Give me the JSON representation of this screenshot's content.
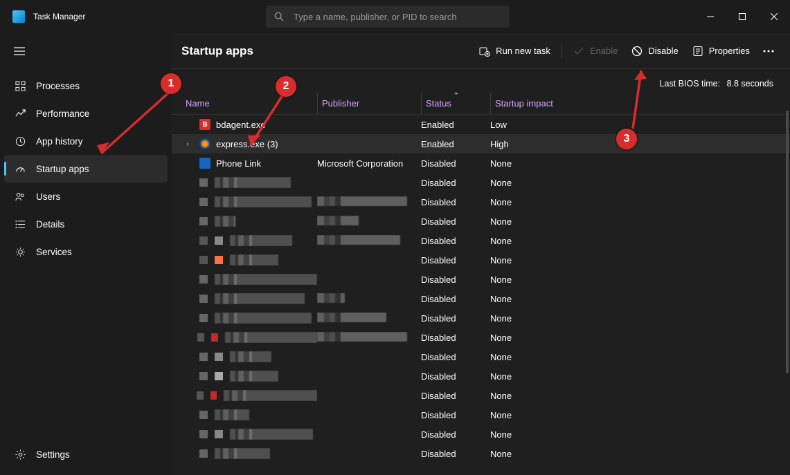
{
  "app": {
    "title": "Task Manager"
  },
  "search": {
    "placeholder": "Type a name, publisher, or PID to search"
  },
  "window": {
    "minimize": "−",
    "maximize": "▢",
    "close": "✕"
  },
  "sidebar": {
    "items": [
      {
        "icon": "processes",
        "label": "Processes"
      },
      {
        "icon": "performance",
        "label": "Performance"
      },
      {
        "icon": "history",
        "label": "App history"
      },
      {
        "icon": "startup",
        "label": "Startup apps"
      },
      {
        "icon": "users",
        "label": "Users"
      },
      {
        "icon": "details",
        "label": "Details"
      },
      {
        "icon": "services",
        "label": "Services"
      }
    ],
    "settings": "Settings"
  },
  "page": {
    "title": "Startup apps",
    "toolbar": {
      "run_new_task": "Run new task",
      "enable": "Enable",
      "disable": "Disable",
      "properties": "Properties"
    },
    "bios_label": "Last BIOS time:",
    "bios_value": "8.8 seconds"
  },
  "columns": {
    "name": "Name",
    "publisher": "Publisher",
    "status": "Status",
    "impact": "Startup impact"
  },
  "rows": [
    {
      "icon": "#d32f2f",
      "iconText": "B",
      "name": "bdagent.exe",
      "publisher": "",
      "status": "Enabled",
      "impact": "Low",
      "expandable": false
    },
    {
      "icon": "#0d47a1",
      "iconShield": true,
      "name": "express.exe (3)",
      "publisher": "",
      "status": "Enabled",
      "impact": "High",
      "expandable": true,
      "selected": true
    },
    {
      "icon": "#1565c0",
      "name": "Phone Link",
      "publisher": "Microsoft Corporation",
      "status": "Disabled",
      "impact": "None",
      "expandable": false
    },
    {
      "blurred": true,
      "nameWidth": 110,
      "pubWidth": 0,
      "status": "Disabled",
      "impact": "None"
    },
    {
      "blurred": true,
      "nameWidth": 140,
      "pubWidth": 130,
      "status": "Disabled",
      "impact": "None"
    },
    {
      "blurred": true,
      "nameWidth": 30,
      "pubWidth": 60,
      "status": "Disabled",
      "impact": "None"
    },
    {
      "blurred": true,
      "nameWidth": 90,
      "pubWidth": 120,
      "chips": [
        "#555",
        "#888"
      ],
      "status": "Disabled",
      "impact": "None"
    },
    {
      "blurred": true,
      "nameWidth": 70,
      "pubWidth": 0,
      "chips": [
        "#555",
        "#ff7043"
      ],
      "status": "Disabled",
      "impact": "None"
    },
    {
      "blurred": true,
      "nameWidth": 150,
      "pubWidth": 0,
      "status": "Disabled",
      "impact": "None"
    },
    {
      "blurred": true,
      "nameWidth": 130,
      "pubWidth": 40,
      "status": "Disabled",
      "impact": "None"
    },
    {
      "blurred": true,
      "nameWidth": 140,
      "pubWidth": 100,
      "status": "Disabled",
      "impact": "None"
    },
    {
      "blurred": true,
      "nameWidth": 160,
      "pubWidth": 130,
      "chips": [
        "#555",
        "#c62828"
      ],
      "status": "Disabled",
      "impact": "None"
    },
    {
      "blurred": true,
      "nameWidth": 60,
      "pubWidth": 0,
      "chips": [
        "#666",
        "#888"
      ],
      "status": "Disabled",
      "impact": "None"
    },
    {
      "blurred": true,
      "nameWidth": 70,
      "pubWidth": 0,
      "chips": [
        "#666",
        "#aaa"
      ],
      "status": "Disabled",
      "impact": "None"
    },
    {
      "blurred": true,
      "nameWidth": 170,
      "pubWidth": 0,
      "chips": [
        "#555",
        "#c62828"
      ],
      "status": "Disabled",
      "impact": "None"
    },
    {
      "blurred": true,
      "nameWidth": 50,
      "pubWidth": 0,
      "status": "Disabled",
      "impact": "None"
    },
    {
      "blurred": true,
      "nameWidth": 120,
      "pubWidth": 0,
      "chips": [
        "#666",
        "#888"
      ],
      "status": "Disabled",
      "impact": "None"
    },
    {
      "blurred": true,
      "nameWidth": 80,
      "pubWidth": 0,
      "status": "Disabled",
      "impact": "None"
    }
  ],
  "annotations": {
    "b1": "1",
    "b2": "2",
    "b3": "3"
  }
}
